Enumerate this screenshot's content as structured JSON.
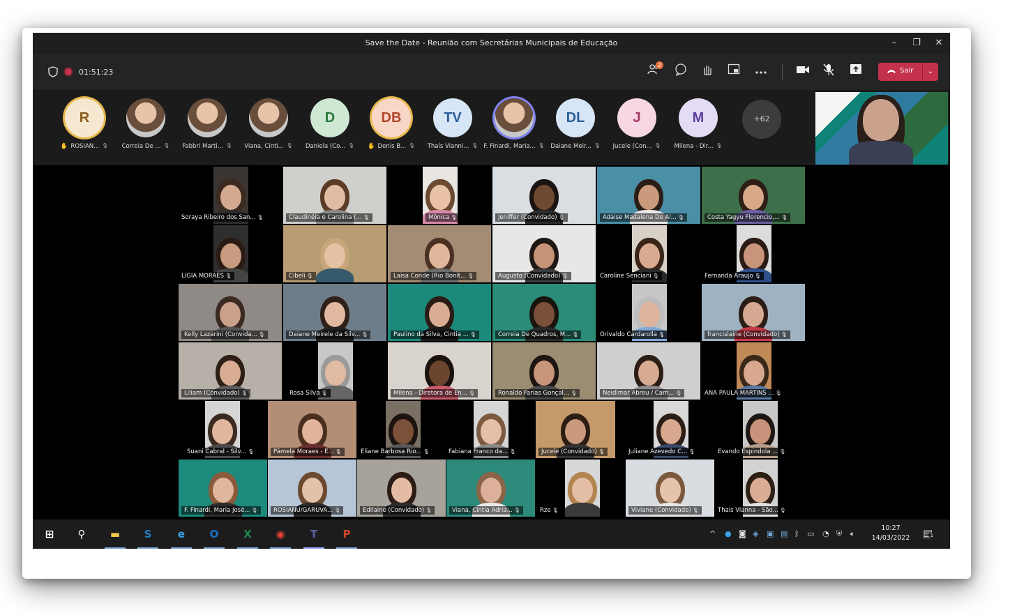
{
  "window": {
    "title": "Save the Date - Reunião com Secretárias Municipais de Educação",
    "controls": {
      "minimize": "–",
      "maximize": "❐",
      "close": "✕"
    }
  },
  "toolbar": {
    "timer": "01:51:23",
    "participants_badge": "2",
    "leave_label": "Sair"
  },
  "strip": {
    "avatars": [
      {
        "initials": "R",
        "name": "ROSIAN...",
        "bg": "#f6e7d0",
        "fg": "#8a5a1a",
        "ring": true,
        "hand": true
      },
      {
        "initials": "",
        "name": "Correia De ...",
        "photo": true
      },
      {
        "initials": "",
        "name": "Fabbri Marti...",
        "photo": true
      },
      {
        "initials": "",
        "name": "Viana, Cinti...",
        "photo": true
      },
      {
        "initials": "D",
        "name": "Daniela (Co...",
        "bg": "#cfe8d4",
        "fg": "#2b7a3c"
      },
      {
        "initials": "DB",
        "name": "Denis B...",
        "bg": "#f9d7c6",
        "fg": "#b2462a",
        "ring": true,
        "hand": true
      },
      {
        "initials": "TV",
        "name": "Thaís Vianni...",
        "bg": "#d7e6f7",
        "fg": "#2c5f9a"
      },
      {
        "initials": "",
        "name": "F. Finardi, Maria...",
        "photo": true,
        "ring_blue": true
      },
      {
        "initials": "DL",
        "name": "Daiane Meir...",
        "bg": "#d7e6f7",
        "fg": "#2c5f9a"
      },
      {
        "initials": "J",
        "name": "Jucele (Con...",
        "bg": "#f7d7e4",
        "fg": "#a33866"
      },
      {
        "initials": "M",
        "name": "Milena - Dir...",
        "bg": "#e4dcf5",
        "fg": "#5b3fa0"
      }
    ],
    "overflow_label": "+62"
  },
  "grid": [
    {
      "name": "Soraya Ribeiro dos San...",
      "bg": "#3a3530",
      "skin": "#d3a98f",
      "hair": "#3b2a1f",
      "shirt": "#2c2c2c"
    },
    {
      "name": "Claudinéia e Carolina (...",
      "bg": "#cfcfcc",
      "skin": "#e0bca3",
      "hair": "#5b3b26",
      "shirt": "#8a8a8a"
    },
    {
      "name": "Mônica",
      "bg": "#e9e6e2",
      "skin": "#e9c1a6",
      "hair": "#6b4a33",
      "shirt": "#d78aa8"
    },
    {
      "name": "Jeniffer (Convidado)",
      "bg": "#d9dee2",
      "skin": "#6e4a33",
      "hair": "#1c1410",
      "shirt": "#2d2d2d"
    },
    {
      "name": "Adaise Madalena De Al...",
      "bg": "#4b8fa6",
      "skin": "#c99a7c",
      "hair": "#2a1d15",
      "shirt": "#e7e7e7"
    },
    {
      "name": "Costa Yagyu Florencio,...",
      "bg": "#3d6f4b",
      "skin": "#d7a989",
      "hair": "#2d1f16",
      "shirt": "#6a5fa0"
    },
    {
      "name": "LIGIA MORAES",
      "bg": "#2e2e2e",
      "skin": "#c99b80",
      "hair": "#2a1c14",
      "shirt": "#444"
    },
    {
      "name": "Cibeli",
      "bg": "#b89c73",
      "skin": "#e6c2a5",
      "hair": "#c7a67a",
      "shirt": "#355a6b"
    },
    {
      "name": "Laisa Conde (Rio Bonit...",
      "bg": "#a38b74",
      "skin": "#e0b79b",
      "hair": "#4a3123",
      "shirt": "#6b6b6b"
    },
    {
      "name": "Augusto (Convidado)",
      "bg": "#e7e7e7",
      "skin": "#c69377",
      "hair": "#1f1712",
      "shirt": "#3a3a3a"
    },
    {
      "name": "Caroline Senciani",
      "bg": "#d7d1c8",
      "skin": "#d8ab90",
      "hair": "#3a2618",
      "shirt": "#2a2a2a"
    },
    {
      "name": "Fernanda Araujo",
      "bg": "#dcdcdc",
      "skin": "#c9957a",
      "hair": "#2a1c14",
      "shirt": "#2f4f8a"
    },
    {
      "name": "Kelly Lazarini (Convida...",
      "bg": "#8f8a86",
      "skin": "#caa08a",
      "hair": "#3b2a22",
      "shirt": "#555"
    },
    {
      "name": "Daiane Meirele da Silv...",
      "bg": "#6e7d8a",
      "skin": "#e1b8a0",
      "hair": "#2f2118",
      "shirt": "#1f1f1f"
    },
    {
      "name": "Paulino da Silva, Cintia ...",
      "bg": "#1b8a7c",
      "skin": "#d9ad93",
      "hair": "#2a1b14",
      "shirt": "#1a1a1a"
    },
    {
      "name": "Correia De Quadros, M...",
      "bg": "#2a8c79",
      "skin": "#7a5038",
      "hair": "#1a1410",
      "shirt": "#2b2b2b"
    },
    {
      "name": "Orivaldo Cardarolla",
      "bg": "#c7c7c7",
      "skin": "#deb39c",
      "hair": "#bdbdbd",
      "shirt": "#7fa9d6"
    },
    {
      "name": "francislaine (Convidado)",
      "bg": "#9fb2c2",
      "skin": "#d7a891",
      "hair": "#2b1d16",
      "shirt": "#c93b4b"
    },
    {
      "name": "Liliam (Convidado)",
      "bg": "#b6b0a8",
      "skin": "#d9ad93",
      "hair": "#2d1f16",
      "shirt": "#5c5c5c"
    },
    {
      "name": "Rosa Silva",
      "bg": "#c8c8c8",
      "skin": "#e2bba3",
      "hair": "#9a9a9a",
      "shirt": "#666"
    },
    {
      "name": "Milena - Diretora de En...",
      "bg": "#d8d3cc",
      "skin": "#6b452e",
      "hair": "#1a120d",
      "shirt": "#c95a6a"
    },
    {
      "name": "Ronaldo Farias Gonçal...",
      "bg": "#9b8d72",
      "skin": "#c7957a",
      "hair": "#1f1510",
      "shirt": "#4a4a4a"
    },
    {
      "name": "Neidimar Abreu / Cam...",
      "bg": "#cfcfcf",
      "skin": "#d6ab91",
      "hair": "#2c1d14",
      "shirt": "#8a8a8a"
    },
    {
      "name": "ANA PAULA MARTINS ...",
      "bg": "#c08a58",
      "skin": "#d7a88d",
      "hair": "#3a2818",
      "shirt": "#5978a0"
    },
    {
      "name": "Suani Cabral - Silv...",
      "bg": "#d5d5d5",
      "skin": "#e0b69d",
      "hair": "#3a2a20",
      "shirt": "#4c4c4c"
    },
    {
      "name": "Pâmela Moraes - E...",
      "bg": "#b38e75",
      "skin": "#e0b49b",
      "hair": "#4a2e1e",
      "shirt": "#6b2e2e"
    },
    {
      "name": "Eliane Barbosa Rio...",
      "bg": "#7a7064",
      "skin": "#7b5139",
      "hair": "#1c1410",
      "shirt": "#5a5a5a"
    },
    {
      "name": "Fabiana Franco da...",
      "bg": "#d6d6d6",
      "skin": "#e5c0a8",
      "hair": "#7b5a40",
      "shirt": "#8a8a8a"
    },
    {
      "name": "Jucele (Convidado)",
      "bg": "#c49a6a",
      "skin": "#c99a7d",
      "hair": "#2b1c14",
      "shirt": "#333"
    },
    {
      "name": "Juliane Azevedo C...",
      "bg": "#d9d9d9",
      "skin": "#d8a98f",
      "hair": "#2c1e16",
      "shirt": "#3a4a6a"
    },
    {
      "name": "Evando Espindola ...",
      "bg": "#c8c8c8",
      "skin": "#c8937a",
      "hair": "#1d1612",
      "shirt": "#b7a08a"
    },
    {
      "name": "F. Finardi, Maria José...",
      "bg": "#1d8a7d",
      "skin": "#e0b69c",
      "hair": "#8a5a3a",
      "shirt": "#2d2d2d"
    },
    {
      "name": "ROSIANU/GARUVA...",
      "bg": "#b6c6d6",
      "skin": "#e4c1a9",
      "hair": "#6b4a30",
      "shirt": "#2a2a2a"
    },
    {
      "name": "Edilaine (Convidado)",
      "bg": "#a7a39b",
      "skin": "#e4bca4",
      "hair": "#2b1d16",
      "shirt": "#2d2d2d"
    },
    {
      "name": "Viana, Cintia Adria...",
      "bg": "#2c8a7a",
      "skin": "#dcb09a",
      "hair": "#8a6446",
      "shirt": "#e9e9e9"
    },
    {
      "name": "Rze",
      "bg": "#d7d7d7",
      "skin": "#e4bda5",
      "hair": "#b38450",
      "shirt": "#3a3a3a"
    },
    {
      "name": "Viviane (Convidado)",
      "bg": "#d9dde2",
      "skin": "#e6c3ab",
      "hair": "#7b5a3e",
      "shirt": "#e7e7e7"
    },
    {
      "name": "Thais Vianna - São...",
      "bg": "#d2d2d2",
      "skin": "#d9ac93",
      "hair": "#2d1f16",
      "shirt": "#e0e0e0"
    }
  ],
  "taskbar": {
    "apps": [
      {
        "icon": "windows-start-icon",
        "glyph": "⊞",
        "color": "#ffffff"
      },
      {
        "icon": "search-icon",
        "glyph": "⚲",
        "color": "#ffffff"
      },
      {
        "icon": "file-explorer-icon",
        "glyph": "▬",
        "color": "#f2c94c"
      },
      {
        "icon": "sway-icon",
        "glyph": "S",
        "color": "#1f7fbf"
      },
      {
        "icon": "edge-icon",
        "glyph": "e",
        "color": "#3aa0e8"
      },
      {
        "icon": "outlook-icon",
        "glyph": "O",
        "color": "#1a73c9"
      },
      {
        "icon": "excel-icon",
        "glyph": "X",
        "color": "#1d8a4a"
      },
      {
        "icon": "chrome-icon",
        "glyph": "◉",
        "color": "#e94235"
      },
      {
        "icon": "teams-icon",
        "glyph": "T",
        "color": "#6264a7"
      },
      {
        "icon": "powerpoint-icon",
        "glyph": "P",
        "color": "#d24726"
      }
    ],
    "time": "10:27",
    "date": "14/03/2022",
    "notification_count": "1"
  }
}
